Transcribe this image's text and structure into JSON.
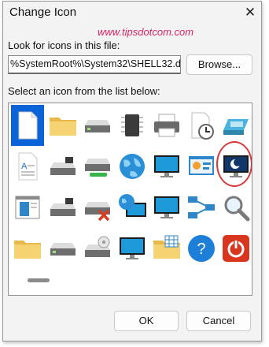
{
  "window": {
    "title": "Change Icon",
    "close_glyph": "✕"
  },
  "watermark": "www.tipsdotcom.com",
  "look_label": "Look for icons in this file:",
  "file_value": "%SystemRoot%\\System32\\SHELL32.dll",
  "browse_label": "Browse...",
  "select_label": "Select an icon from the list below:",
  "icons": [
    [
      "document-icon",
      "folder-icon",
      "drive-icon",
      "chip-icon",
      "printer-icon",
      "clock-icon",
      "removable-drive-icon"
    ],
    [
      "text-document-icon",
      "floppy-drive-icon",
      "drive-green-icon",
      "globe-icon",
      "monitor-icon",
      "control-panel-icon",
      "monitor-moon-icon"
    ],
    [
      "window-app-icon",
      "floppy-drive-icon",
      "drive-x-icon",
      "globe-monitor-icon",
      "monitor-icon",
      "network-icon",
      "magnifier-icon",
      "drive-arrow-icon"
    ],
    [
      "folder-icon",
      "drive-icon",
      "cd-drive-icon",
      "monitor-icon",
      "folder-grid-icon",
      "help-icon",
      "power-icon"
    ]
  ],
  "selected_icon": "document-icon",
  "highlighted_icon": "monitor-moon-icon",
  "ok_label": "OK",
  "cancel_label": "Cancel",
  "colors": {
    "selection": "#0a64d8",
    "highlight_ring": "#d33a3a",
    "watermark": "#d8275f"
  }
}
